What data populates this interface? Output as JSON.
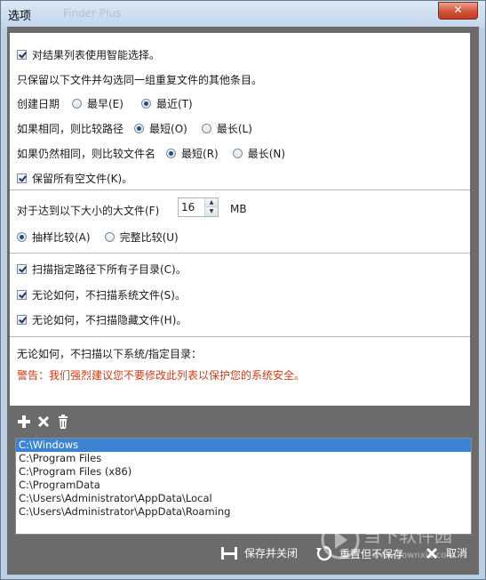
{
  "window": {
    "title": "选项",
    "ghost_title": "Finder Plus",
    "close_label": "✕"
  },
  "options": {
    "smart_select": "对结果列表使用智能选择。",
    "keep_one_desc": "只保留以下文件并勾选同一组重复文件的其他条目。",
    "created_date": {
      "label": "创建日期",
      "earliest": "最早(E)",
      "latest": "最近(T)"
    },
    "if_same_path": {
      "label": "如果相同，则比较路径",
      "shortest": "最短(O)",
      "longest": "最长(L)"
    },
    "if_still_same_name": {
      "label": "如果仍然相同，则比较文件名",
      "shortest": "最短(R)",
      "longest": "最长(N)"
    },
    "keep_empty": "保留所有空文件(K)。",
    "large_file": {
      "label": "对于达到以下大小的大文件(F)",
      "value": "16",
      "unit": "MB"
    },
    "sample_compare": "抽样比较(A)",
    "full_compare": "完整比较(U)",
    "scan_subdirs": "扫描指定路径下所有子目录(C)。",
    "skip_system": "无论如何，不扫描系统文件(S)。",
    "skip_hidden": "无论如何，不扫描隐藏文件(H)。",
    "excluded_header": "无论如何，不扫描以下系统/指定目录：",
    "warning": "警告：我们强烈建议您不要修改此列表以保护您的系统安全。"
  },
  "toolbar": {
    "add_icon": "plus-icon",
    "remove_icon": "x-icon",
    "delete_icon": "trash-icon"
  },
  "excluded_dirs": [
    "C:\\Windows",
    "C:\\Program Files",
    "C:\\Program Files (x86)",
    "C:\\ProgramData",
    "C:\\Users\\Administrator\\AppData\\Local",
    "C:\\Users\\Administrator\\AppData\\Roaming"
  ],
  "buttons": {
    "save_close": "保存并关闭",
    "reset_no_save": "重置但不保存",
    "cancel": "取消"
  },
  "watermark": {
    "cn": "当下软件园",
    "en": "www.downxia.com"
  },
  "colors": {
    "warning": "#d23a14",
    "selection": "#3b84d4",
    "frame": "#6b6b6b"
  }
}
